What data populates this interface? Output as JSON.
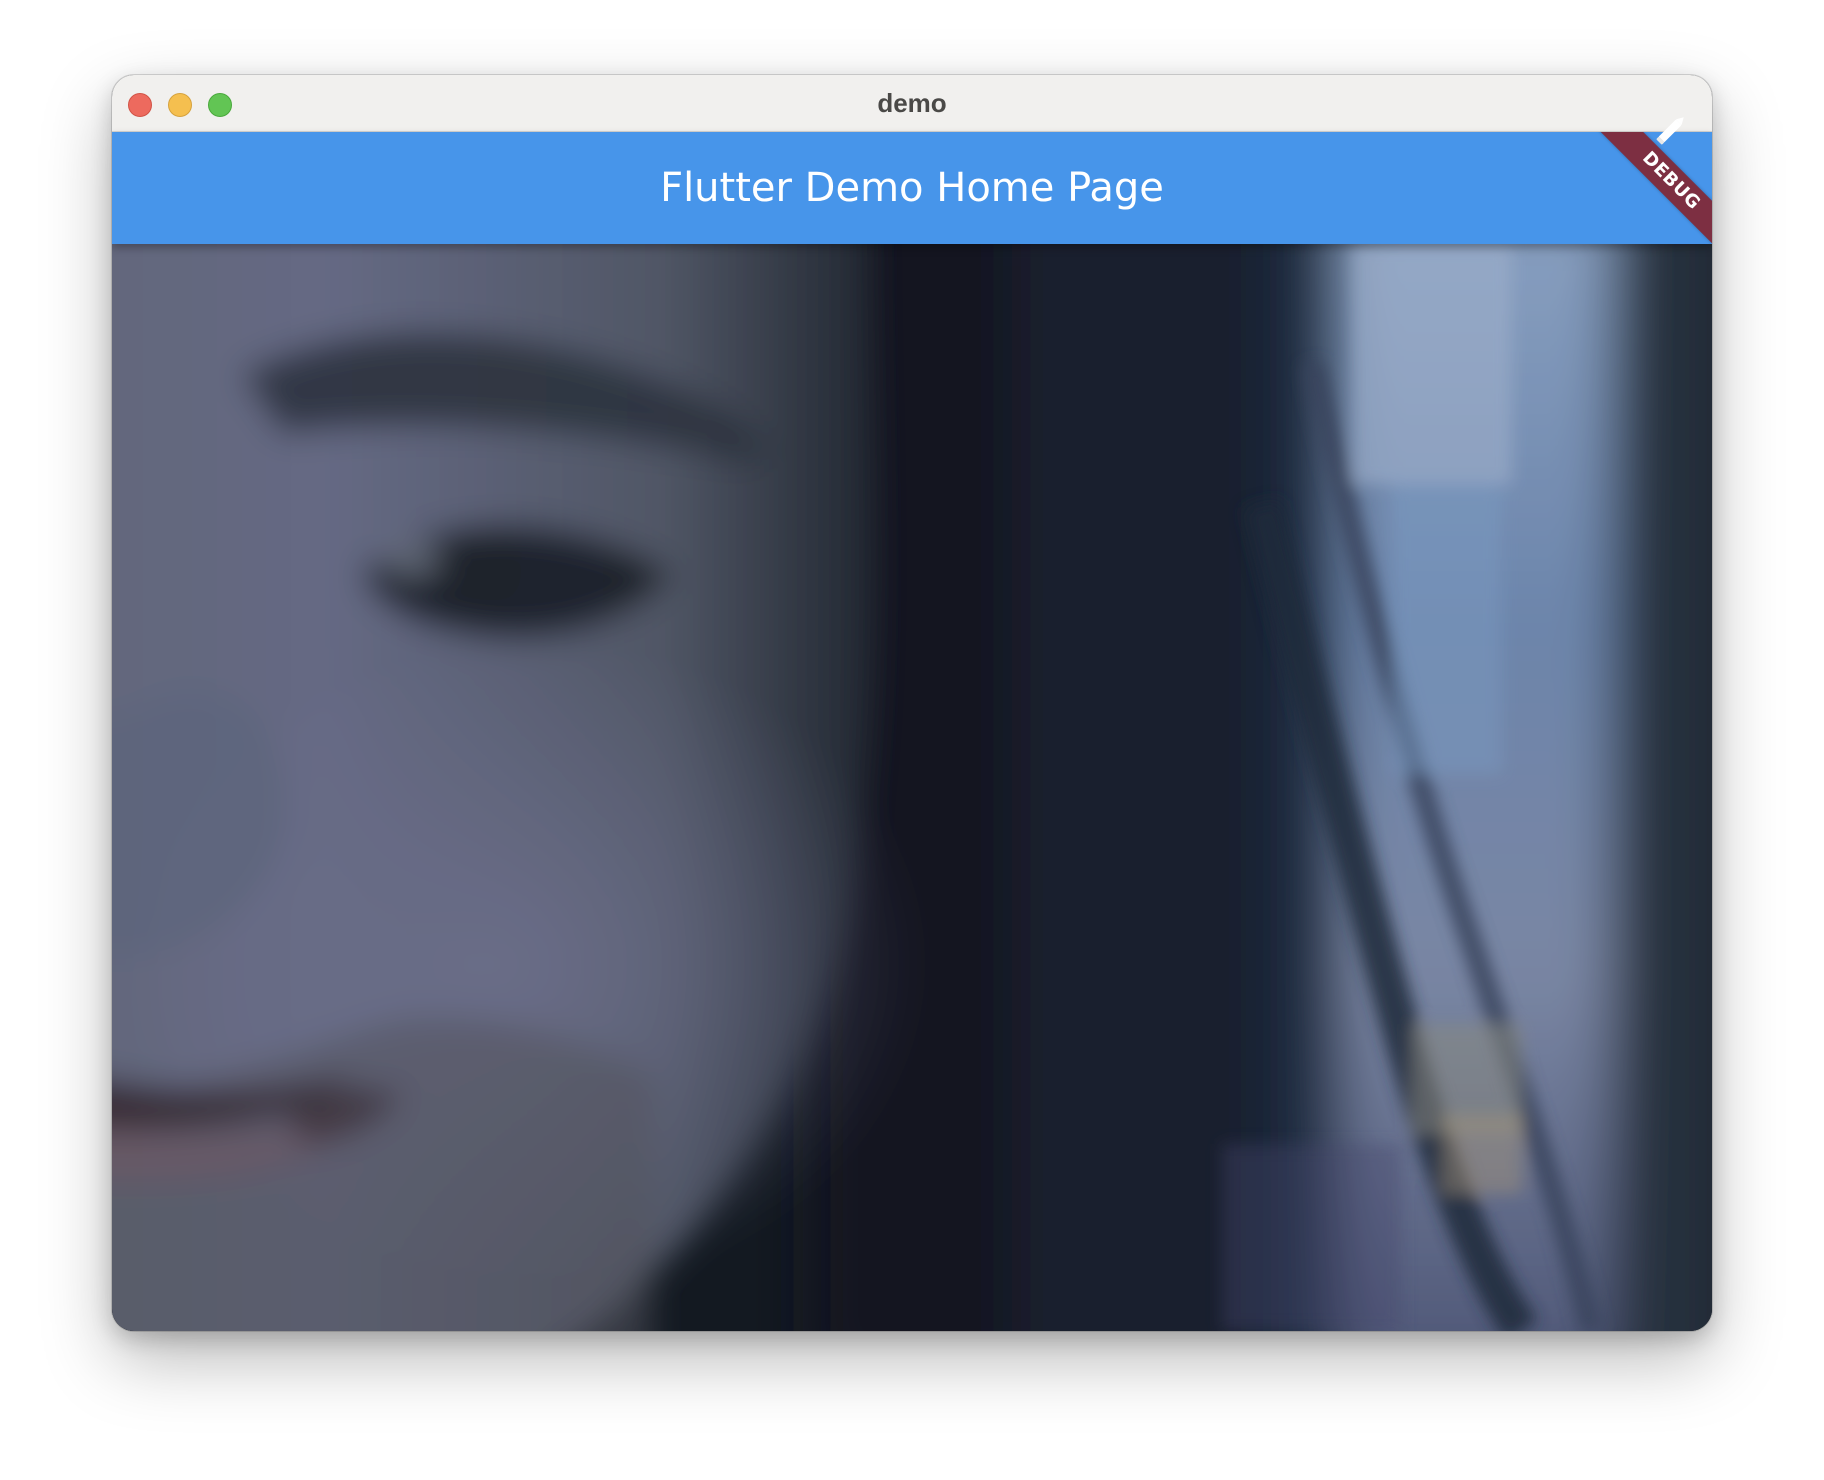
{
  "window": {
    "title": "demo"
  },
  "app_bar": {
    "title": "Flutter Demo Home Page",
    "color": "#4795ea"
  },
  "debug_banner": {
    "label": "DEBUG",
    "color": "#7d2f42"
  },
  "camera_preview": {
    "description_icon": "camera-feed"
  },
  "colors": {
    "traffic_close": "#ed6a5e",
    "traffic_minimize": "#f5bf4f",
    "traffic_zoom": "#62c554",
    "titlebar": "#f1f0ee"
  }
}
